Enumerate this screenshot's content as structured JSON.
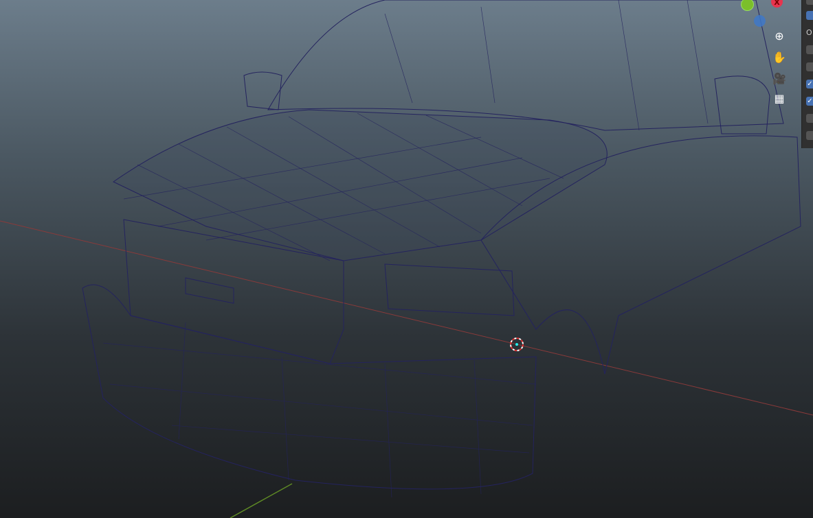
{
  "gizmo": {
    "x_label": "X",
    "colors": {
      "x": "#e8344e",
      "y": "#7bbf2a",
      "z": "#3f78c8"
    }
  },
  "nav_icons": [
    "zoom-icon",
    "pan-hand-icon",
    "camera-icon",
    "ortho-grid-icon"
  ],
  "side_panel": {
    "label": "O",
    "checkboxes": [
      false,
      false,
      true,
      true,
      false,
      false
    ]
  },
  "colors": {
    "wire": "#24235e",
    "x_axis": "#9a3a3a",
    "y_axis": "#5e8a25",
    "cursor": "#e03030"
  }
}
